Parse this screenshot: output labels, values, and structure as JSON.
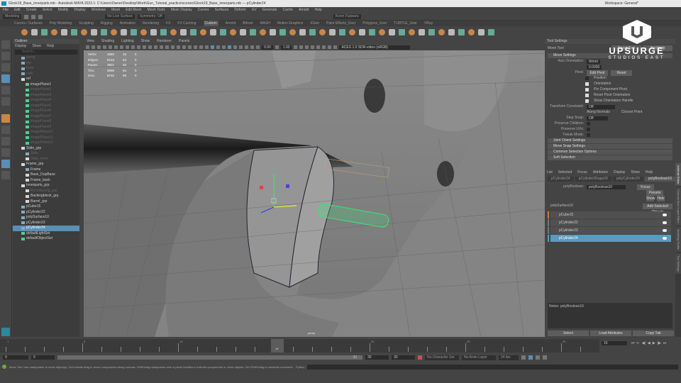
{
  "window": {
    "title": "Glock19_Base_innerparts.mb - Autodesk MAYA 2023.1: C:\\Users\\Owner\\Desktop\\Work\\Gun_Tutorial_practice\\scenes\\Glock19_Base_innerparts.mb --- pCylinder24",
    "workspace": "Workspace: General*"
  },
  "menu": [
    "File",
    "Edit",
    "Create",
    "Select",
    "Modify",
    "Display",
    "Windows",
    "Mesh",
    "Edit Mesh",
    "Mesh Tools",
    "Mesh Display",
    "Curves",
    "Surfaces",
    "Deform",
    "UV",
    "Generate",
    "Cache",
    "Arnold",
    "Help"
  ],
  "status": {
    "mode": "Modeling",
    "live": "No Live Surface",
    "symmetry": "Symmetry: Off",
    "user": "Kevin Fujiwara"
  },
  "shelf_tabs": [
    "Curves / Surfaces",
    "Poly Modeling",
    "Sculpting",
    "Rigging",
    "Animation",
    "Rendering",
    "FX",
    "FX Caching",
    "Custom",
    "Arnold",
    "Bifrost",
    "MASH",
    "Motion Graphics",
    "XGen",
    "Paint Effects_User",
    "Polygons_User",
    "TURTLE_User",
    "VRay"
  ],
  "shelf_active": "Custom",
  "outliner": {
    "title": "Outliner",
    "menu": [
      "Display",
      "Show",
      "Help"
    ],
    "search_placeholder": "Search...",
    "items": [
      {
        "label": "persp",
        "type": "cam",
        "dim": true,
        "depth": 1
      },
      {
        "label": "top",
        "type": "cam",
        "dim": true,
        "depth": 1
      },
      {
        "label": "front",
        "type": "cam",
        "dim": true,
        "depth": 1
      },
      {
        "label": "side",
        "type": "cam",
        "dim": true,
        "depth": 1
      },
      {
        "label": "ref",
        "type": "grp",
        "depth": 1
      },
      {
        "label": "imagePlane1",
        "type": "img",
        "depth": 2
      },
      {
        "label": "imagePlane2",
        "type": "img",
        "dim": true,
        "depth": 2
      },
      {
        "label": "imagePlane3",
        "type": "img",
        "dim": true,
        "depth": 2
      },
      {
        "label": "imagePlane4",
        "type": "img",
        "dim": true,
        "depth": 2
      },
      {
        "label": "imagePlane5",
        "type": "img",
        "dim": true,
        "depth": 2
      },
      {
        "label": "imagePlane6",
        "type": "img",
        "dim": true,
        "depth": 2
      },
      {
        "label": "imagePlane7",
        "type": "img",
        "dim": true,
        "depth": 2
      },
      {
        "label": "imagePlane8",
        "type": "img",
        "dim": true,
        "depth": 2
      },
      {
        "label": "imagePlane9",
        "type": "img",
        "dim": true,
        "depth": 2
      },
      {
        "label": "imagePlane10",
        "type": "img",
        "dim": true,
        "depth": 2
      },
      {
        "label": "imagePlane11",
        "type": "img",
        "dim": true,
        "depth": 2
      },
      {
        "label": "imagePlane12",
        "type": "img",
        "dim": true,
        "depth": 2
      },
      {
        "label": "Slide_grp",
        "type": "grp",
        "depth": 1
      },
      {
        "label": "Slide",
        "type": "mesh",
        "dim": true,
        "depth": 2
      },
      {
        "label": "Slide_inner",
        "type": "grp",
        "dim": true,
        "depth": 2
      },
      {
        "label": "Frame_grp",
        "type": "grp",
        "depth": 1
      },
      {
        "label": "Frame",
        "type": "mesh",
        "depth": 2
      },
      {
        "label": "Base_DupBase",
        "type": "grp",
        "depth": 2
      },
      {
        "label": "Frame_back",
        "type": "grp",
        "depth": 2
      },
      {
        "label": "Innerparts_grp",
        "type": "grp",
        "depth": 1
      },
      {
        "label": "Recoilspring_grp",
        "type": "grp",
        "dim": true,
        "depth": 2
      },
      {
        "label": "Backingblock_grp",
        "type": "grp",
        "depth": 2
      },
      {
        "label": "Barrel_grp",
        "type": "grp",
        "depth": 2
      },
      {
        "label": "pCube15",
        "type": "mesh",
        "depth": 1
      },
      {
        "label": "pCylinder22",
        "type": "mesh",
        "depth": 1
      },
      {
        "label": "polySurface10",
        "type": "mesh",
        "depth": 1
      },
      {
        "label": "pCylinder23",
        "type": "mesh",
        "depth": 1
      },
      {
        "label": "pCylinder24",
        "type": "mesh",
        "selected": true,
        "depth": 1
      },
      {
        "label": "defaultLightSet",
        "type": "img",
        "depth": 1
      },
      {
        "label": "defaultObjectSet",
        "type": "img",
        "depth": 1
      }
    ]
  },
  "viewport": {
    "menu": [
      "View",
      "Shading",
      "Lighting",
      "Show",
      "Renderer",
      "Panels"
    ],
    "exposure": "0.00",
    "gamma": "1.00",
    "colorspace": "ACES 1.0 SDR-video (sRGB)",
    "camera": "persp",
    "stats": [
      [
        "Verts:",
        "4660",
        "34",
        "0"
      ],
      [
        "Edges:",
        "8134",
        "64",
        "0"
      ],
      [
        "Faces:",
        "3821",
        "40",
        "0"
      ],
      [
        "Tris:",
        "6656",
        "64",
        "0"
      ],
      [
        "UVs:",
        "8732",
        "68",
        "0"
      ]
    ]
  },
  "tool_settings": {
    "title": "Tool Settings",
    "tool": "Move Tool",
    "reset": "Reset Tool",
    "help": "Tool Help",
    "section": "Move Settings",
    "axis_orientation_label": "Axis Orientation:",
    "axis_orientation": "World",
    "value": "0.0000",
    "pivot_label": "Pivot:",
    "edit_pivot": "Edit Pivot",
    "reset_pivot": "Reset",
    "checks": [
      {
        "label": "Position",
        "on": false
      },
      {
        "label": "Orientation",
        "on": true
      },
      {
        "label": "Pin Component Pivot",
        "on": true
      },
      {
        "label": "Reset Pivot Orientation",
        "on": true
      },
      {
        "label": "Show Orientation Handle",
        "on": true
      }
    ],
    "constraint_label": "Transform Constraint:",
    "constraint": "Off",
    "along_normals": "Along Normals",
    "closest_point": "Closest Point",
    "step_snap_label": "Step Snap:",
    "step_snap": "Off",
    "preserve": [
      "Preserve Children:",
      "Preserve UVs:",
      "Tweak Mode:"
    ],
    "sections": [
      "Joint Orient Settings",
      "Move Snap Settings",
      "Common Selection Options",
      "Soft Selection"
    ]
  },
  "attr_editor": {
    "menu": [
      "List",
      "Selected",
      "Focus",
      "Attributes",
      "Display",
      "Show",
      "Help"
    ],
    "tabs": [
      "pCylinder24",
      "pCylinderShape24",
      "polyCylinder24",
      "polyBoolean10",
      "boolean1"
    ],
    "active_tab": "polyBoolean10",
    "node_label": "polyBoolean:",
    "node_value": "polyBoolean10",
    "focus": "Focus",
    "presets": "Presets",
    "show": "Show",
    "hide": "Hide",
    "surface": "polySurface10",
    "add_selected": "Add Selected Objects",
    "list": [
      {
        "label": "pCube15",
        "color": "#c87a3a"
      },
      {
        "label": "pCylinder22",
        "color": "#777"
      },
      {
        "label": "pCylinder23",
        "color": "#777"
      },
      {
        "label": "pCylinder24",
        "color": "#5a9bc0",
        "selected": true
      }
    ],
    "notes": "Notes: polyBoolean10",
    "select": "Select",
    "load_attributes": "Load Attributes",
    "copy_tab": "Copy Tab"
  },
  "side_tabs": [
    "Attribute Editor",
    "Channel Box / Layer Editor",
    "Modeling Toolkit",
    "Tool Settings"
  ],
  "timeline": {
    "ticks": [
      "1",
      "5",
      "10",
      "15",
      "20",
      "25",
      "30"
    ],
    "current": "15",
    "frame_field": "15",
    "start": "0",
    "start2": "0",
    "end": "30",
    "end2": "30",
    "range_end": "30",
    "char_set": "No Character Set",
    "anim_layer": "No Anim Layer",
    "fps": "24 fps"
  },
  "command": {
    "help": "Move Tool: Use manipulator to move object(s). Ctrl+middle-drag to move components along normals. Shift+drag manipulator axis or plane handles to extrude components or clone objects. Ctrl+Shift+drag to constrain movement to a c",
    "lang": "Python"
  },
  "logo": {
    "name": "UPSURGE",
    "sub": "STUDIOS EAST"
  },
  "colors": {
    "selection": "#5a8fb5",
    "panel": "#444444",
    "viewport": "#6d6d6d",
    "boolean_highlight": "#3fe07a"
  }
}
